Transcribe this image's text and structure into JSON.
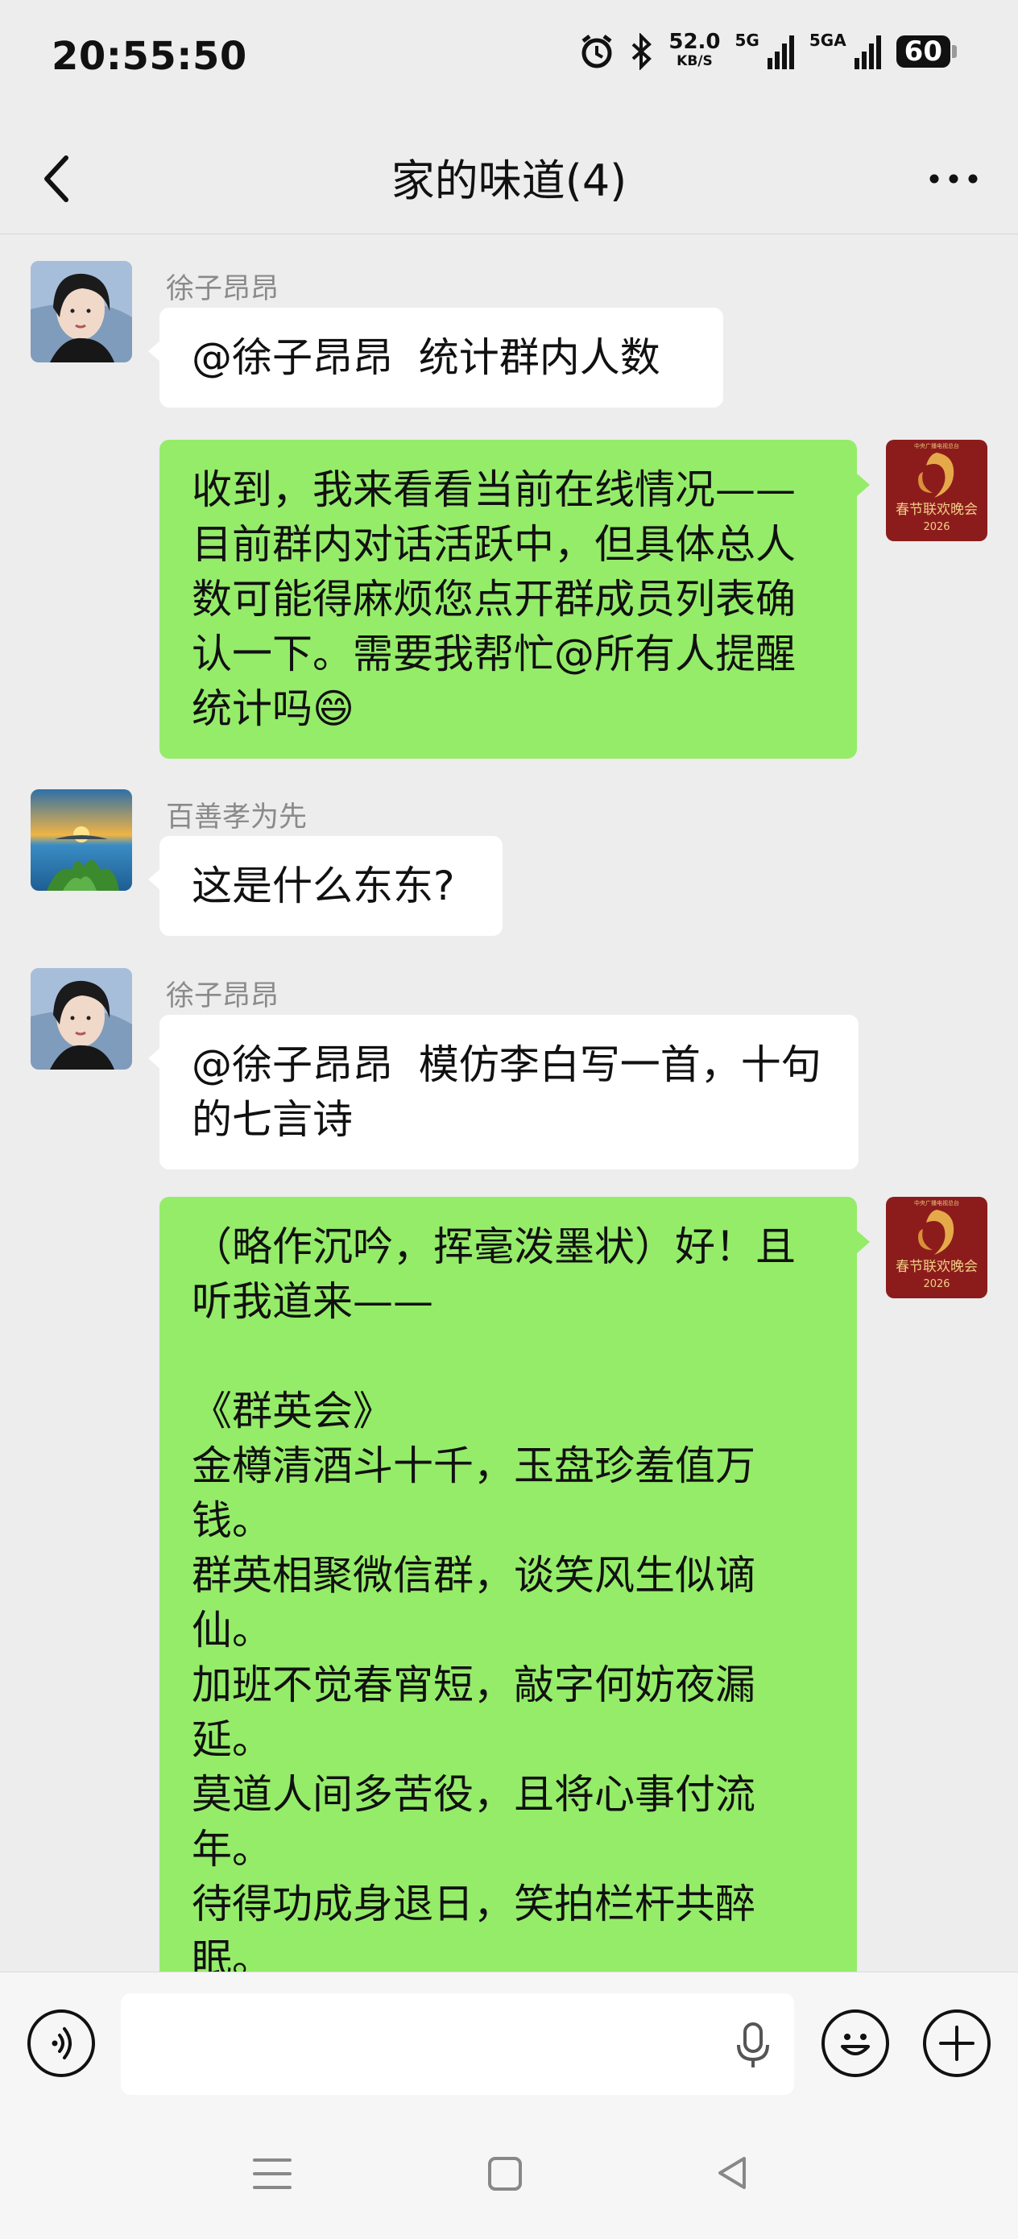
{
  "status_bar": {
    "time": "20:55:50",
    "net_speed": "52.0",
    "net_speed_unit": "KB/S",
    "sim1": "5G",
    "sim2": "5GA",
    "battery": "60"
  },
  "header": {
    "title": "家的味道(4)"
  },
  "messages": [
    {
      "sender": "徐子昂昂",
      "text": "@徐子昂昂  统计群内人数"
    },
    {
      "sender": "",
      "text": "收到，我来看看当前在线情况——目前群内对话活跃中，但具体总人数可能得麻烦您点开群成员列表确认一下。需要我帮忙@所有人提醒统计吗😄"
    },
    {
      "sender": "百善孝为先",
      "text": "这是什么东东?"
    },
    {
      "sender": "徐子昂昂",
      "text": "@徐子昂昂  模仿李白写一首，十句的七言诗"
    },
    {
      "sender": "",
      "text": "（略作沉吟，挥毫泼墨状）好！且听我道来——\n\n《群英会》\n金樽清酒斗十千，玉盘珍羞值万钱。\n群英相聚微信群，谈笑风生似谪仙。\n加班不觉春宵短，敲字何妨夜漏延。\n莫道人间多苦役，且将心事付流年。\n待得功成身退日，笑拍栏杆共醉眠。"
    }
  ],
  "avatars": {
    "bot_text_top": "中央广播电视总台",
    "bot_text_main": "春节联欢晚会",
    "bot_text_year": "2026"
  },
  "colors": {
    "bg": "#ededed",
    "outgoing_bubble": "#95ec69",
    "incoming_bubble": "#ffffff",
    "bot_avatar": "#8c1c1c"
  }
}
